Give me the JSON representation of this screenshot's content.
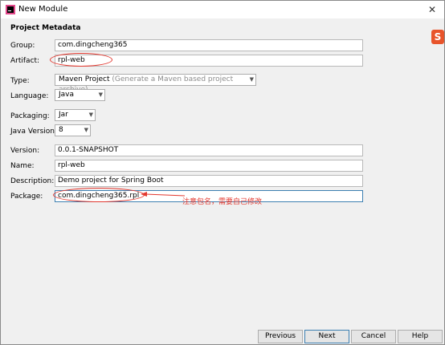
{
  "window": {
    "title": "New Module"
  },
  "section_title": "Project Metadata",
  "fields": {
    "group": {
      "label": "Group:",
      "value": "com.dingcheng365"
    },
    "artifact": {
      "label": "Artifact:",
      "value": "rpl-web"
    },
    "type": {
      "label": "Type:",
      "value": "Maven Project",
      "hint": "(Generate a Maven based project archive)"
    },
    "language": {
      "label": "Language:",
      "value": "Java"
    },
    "packaging": {
      "label": "Packaging:",
      "value": "Jar"
    },
    "java_version": {
      "label": "Java Version:",
      "value": "8"
    },
    "version": {
      "label": "Version:",
      "value": "0.0.1-SNAPSHOT"
    },
    "name": {
      "label": "Name:",
      "value": "rpl-web"
    },
    "description": {
      "label": "Description:",
      "value": "Demo project for Spring Boot"
    },
    "package": {
      "label": "Package:",
      "value": "com.dingcheng365.rpl"
    }
  },
  "annotation": {
    "text": "注意包名，需要自己修改",
    "color": "#e3382f"
  },
  "buttons": {
    "previous": "Previous",
    "next": "Next",
    "cancel": "Cancel",
    "help": "Help"
  },
  "logo_text": "S"
}
